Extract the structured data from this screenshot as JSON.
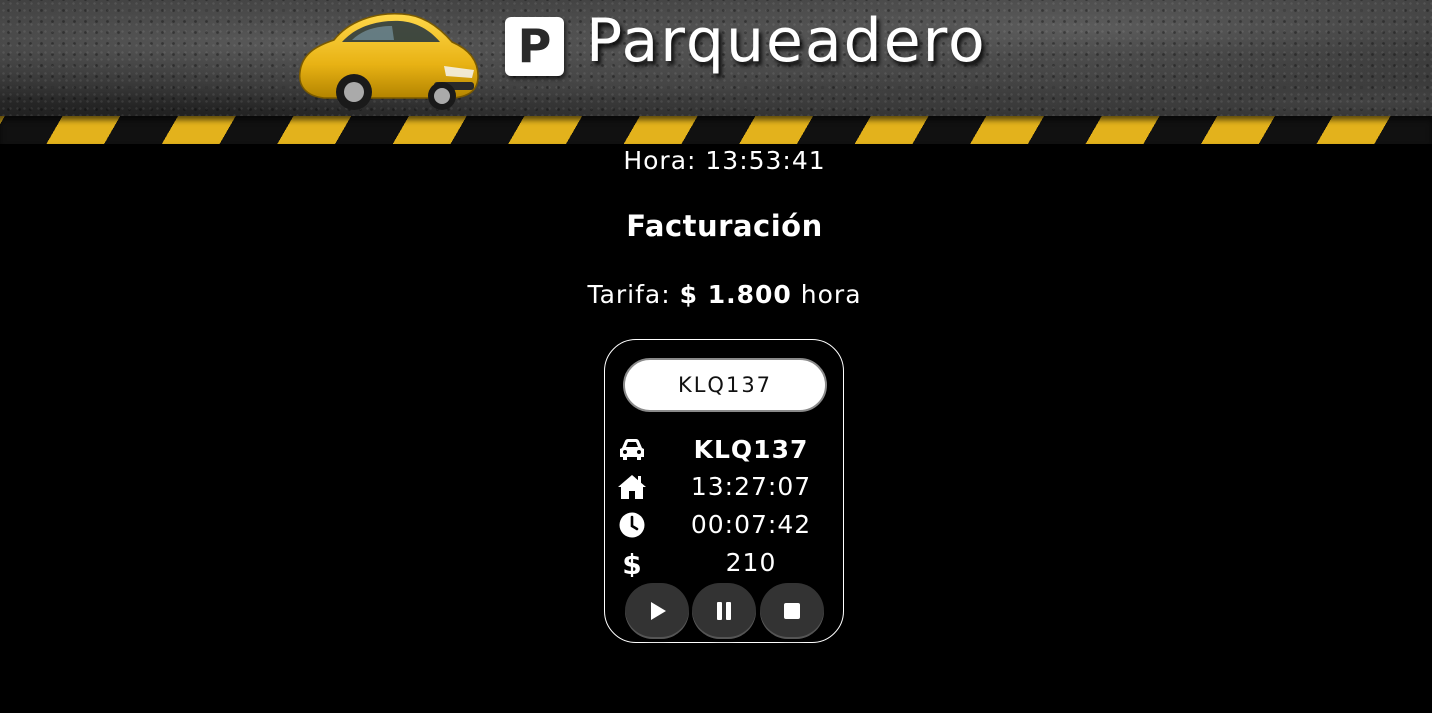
{
  "header": {
    "logo_letter": "P",
    "title": "Parqueadero"
  },
  "clock": {
    "text": "Hora: 13:53:41"
  },
  "section": {
    "heading": "Facturación"
  },
  "tarifa": {
    "label": "Tarifa:",
    "amount": "$ 1.800",
    "unit": "hora"
  },
  "billing": {
    "plate_input_value": "KLQ137",
    "rows": [
      {
        "icon": "car-icon",
        "value": "KLQ137"
      },
      {
        "icon": "home-icon",
        "value": "13:27:07"
      },
      {
        "icon": "clock-icon",
        "value": "00:07:42"
      },
      {
        "icon": "dollar-icon",
        "value": "210"
      }
    ],
    "controls": [
      "play-icon",
      "pause-icon",
      "stop-icon"
    ]
  },
  "colors": {
    "hazard_yellow": "#e3b21c",
    "background": "#000000",
    "button": "#333333"
  }
}
